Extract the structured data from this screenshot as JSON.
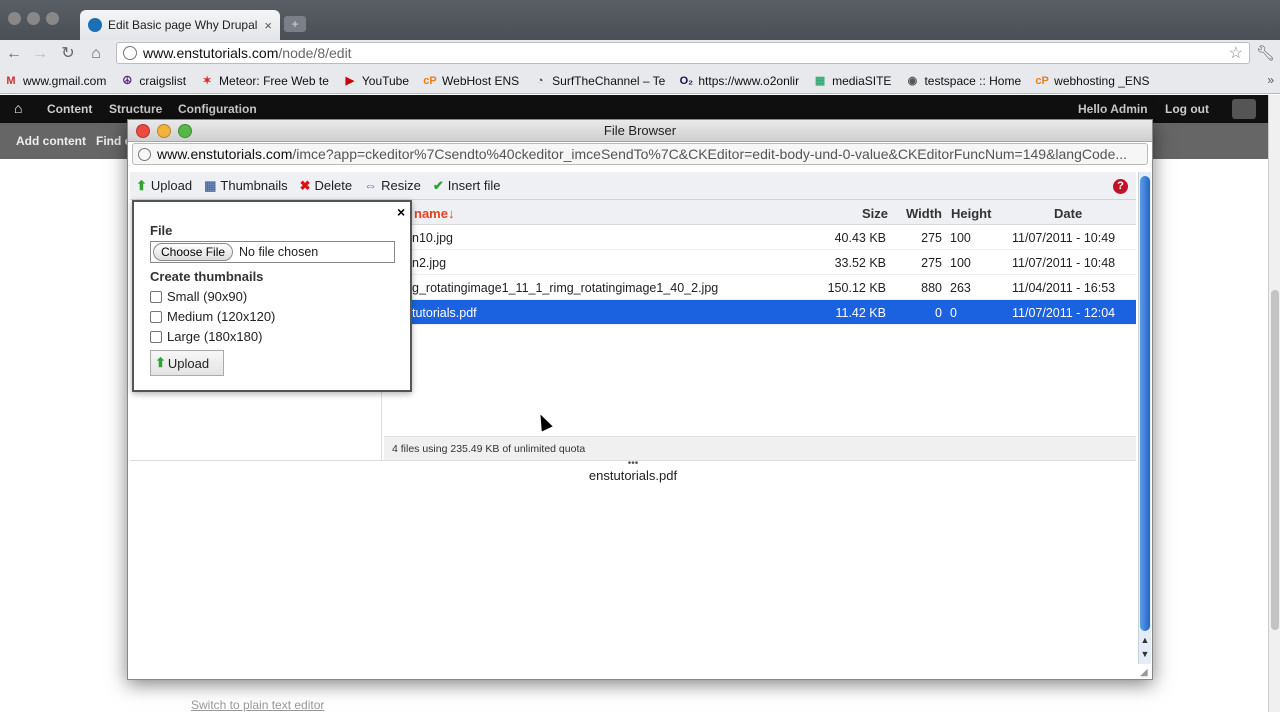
{
  "browser": {
    "tab_title": "Edit Basic page Why Drupal",
    "tab_close": "×",
    "newtab": "+",
    "url_host": "www.enstutorials.com",
    "url_path": "/node/8/edit",
    "bookmarks": [
      {
        "label": "www.gmail.com",
        "icon": "gmail-icon",
        "glyph": "M",
        "color": "#c33"
      },
      {
        "label": "craigslist",
        "icon": "peace-icon",
        "glyph": "☮",
        "color": "#5a2a82"
      },
      {
        "label": "Meteor: Free Web te",
        "icon": "meteor-icon",
        "glyph": "✶",
        "color": "#d22"
      },
      {
        "label": "YouTube",
        "icon": "youtube-icon",
        "glyph": "▶",
        "color": "#c00"
      },
      {
        "label": "WebHost ENS",
        "icon": "cpanel-icon",
        "glyph": "cP",
        "color": "#e87f1e"
      },
      {
        "label": "SurfTheChannel – Te",
        "icon": "surf-icon",
        "glyph": "◔",
        "color": "#444"
      },
      {
        "label": "https://www.o2onlir",
        "icon": "o2-icon",
        "glyph": "O₂",
        "color": "#114"
      },
      {
        "label": "mediaSITE",
        "icon": "mediasite-icon",
        "glyph": "▦",
        "color": "#3a7"
      },
      {
        "label": "testspace :: Home",
        "icon": "globe-icon",
        "glyph": "◉",
        "color": "#555"
      },
      {
        "label": "webhosting _ENS",
        "icon": "cpanel-icon",
        "glyph": "cP",
        "color": "#e87f1e"
      }
    ],
    "bookmarks_more": "»"
  },
  "admin": {
    "home_glyph": "⌂",
    "menu": [
      "Content",
      "Structure",
      "Configuration"
    ],
    "hello": "Hello Admin",
    "logout": "Log out",
    "shortcuts": [
      "Add content",
      "Find c"
    ],
    "switch_editor": "Switch to plain text editor"
  },
  "popup": {
    "title": "File Browser",
    "url_host": "www.enstutorials.com",
    "url_path": "/imce?app=ckeditor%7Csendto%40ckeditor_imceSendTo%7C&CKEditor=edit-body-und-0-value&CKEditorFuncNum=149&langCode...",
    "toolbar": {
      "upload": "Upload",
      "thumbnails": "Thumbnails",
      "delete": "Delete",
      "resize": "Resize",
      "insert": "Insert file",
      "help": "?"
    },
    "columns": {
      "name": "name↓",
      "size": "Size",
      "width": "Width",
      "height": "Height",
      "date": "Date"
    },
    "files": [
      {
        "name": "n10.jpg",
        "size": "40.43 KB",
        "width": "275",
        "height": "100",
        "date": "11/07/2011 - 10:49",
        "selected": false
      },
      {
        "name": "n2.jpg",
        "size": "33.52 KB",
        "width": "275",
        "height": "100",
        "date": "11/07/2011 - 10:48",
        "selected": false
      },
      {
        "name": "g_rotatingimage1_11_1_rimg_rotatingimage1_40_2.jpg",
        "size": "150.12 KB",
        "width": "880",
        "height": "263",
        "date": "11/04/2011 - 16:53",
        "selected": false
      },
      {
        "name": "tutorials.pdf",
        "size": "11.42 KB",
        "width": "0",
        "height": "0",
        "date": "11/07/2011 - 12:04",
        "selected": true
      }
    ],
    "status": "4 files using 235.49 KB of unlimited quota",
    "splitter": "•••",
    "preview_name": "enstutorials.pdf",
    "upload_form": {
      "close": "×",
      "file_label": "File",
      "choose_file": "Choose File",
      "no_file": "No file chosen",
      "thumbs_label": "Create thumbnails",
      "thumbs": [
        "Small (90x90)",
        "Medium (120x120)",
        "Large (180x180)"
      ],
      "submit": "Upload"
    }
  },
  "colors": {
    "selected_row": "#1b62e0",
    "sort_column": "#e8401a",
    "scrollbar_thumb": "#2466c6",
    "close_red": "#ec4a3f",
    "min_yellow": "#f2b33a",
    "max_green": "#56b846"
  }
}
